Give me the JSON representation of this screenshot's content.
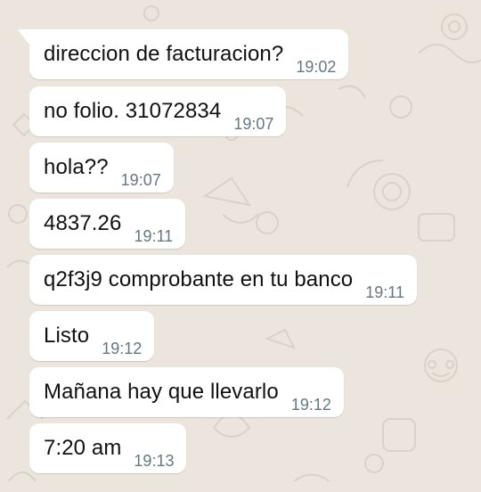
{
  "chat": {
    "background_color": "#ece5dd",
    "bubble_color": "#ffffff",
    "messages": [
      {
        "text": "direccion de facturacion?",
        "time": "19:02"
      },
      {
        "text": "no folio. 31072834",
        "time": "19:07"
      },
      {
        "text": "hola??",
        "time": "19:07"
      },
      {
        "text": "4837.26",
        "time": "19:11"
      },
      {
        "text": "q2f3j9 comprobante en tu banco",
        "time": "19:11"
      },
      {
        "text": "Listo",
        "time": "19:12"
      },
      {
        "text": "Mañana hay que llevarlo",
        "time": "19:12"
      },
      {
        "text": "7:20 am",
        "time": "19:13"
      }
    ]
  }
}
